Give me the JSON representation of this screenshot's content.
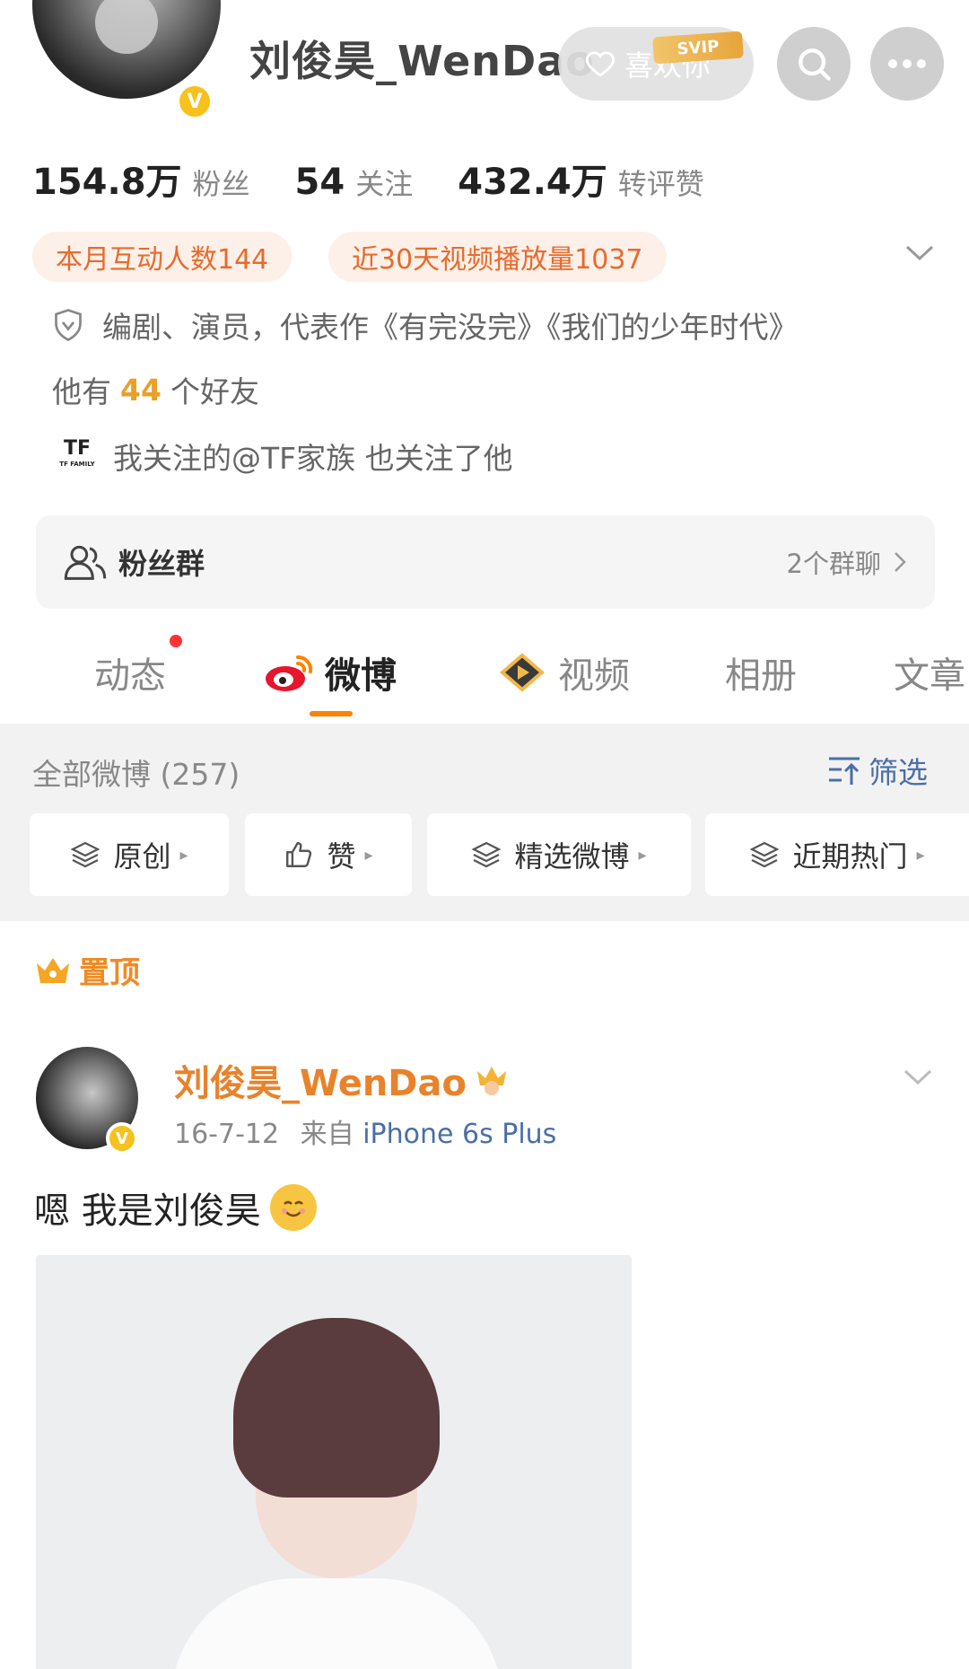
{
  "header": {
    "username": "刘俊昊_WenDao",
    "like_button_label": "喜欢你",
    "vip_badge": "SVIP",
    "verified": "V"
  },
  "stats": [
    {
      "value": "154.8万",
      "label": "粉丝"
    },
    {
      "value": "54",
      "label": "关注"
    },
    {
      "value": "432.4万",
      "label": "转评赞"
    }
  ],
  "tags": {
    "interaction": "本月互动人数144",
    "video_plays": "近30天视频播放量1037"
  },
  "bio": "编剧、演员，代表作《有完没完》《我们的少年时代》",
  "friends": {
    "prefix": "他有",
    "count": "44",
    "suffix": "个好友"
  },
  "mutual": {
    "logo": "TF FAMILY",
    "text": "我关注的@TF家族 也关注了他"
  },
  "fan_group": {
    "label": "粉丝群",
    "count": "2个群聊"
  },
  "tabs": [
    {
      "label": "动态"
    },
    {
      "label": "微博"
    },
    {
      "label": "视频"
    },
    {
      "label": "相册"
    },
    {
      "label": "文章"
    }
  ],
  "feed": {
    "all_label": "全部微博 (257)",
    "filter_label": "筛选",
    "chips": [
      "原创",
      "赞",
      "精选微博",
      "近期热门"
    ]
  },
  "pinned_label": "置顶",
  "post": {
    "author": "刘俊昊_WenDao",
    "date": "16-7-12",
    "from_prefix": "来自",
    "source": "iPhone 6s Plus",
    "text": "嗯 我是刘俊昊"
  },
  "colors": {
    "accent": "#ff8200",
    "tag_text": "#e86a2c",
    "link": "#4a6ea8",
    "verified": "#f6c21b"
  }
}
